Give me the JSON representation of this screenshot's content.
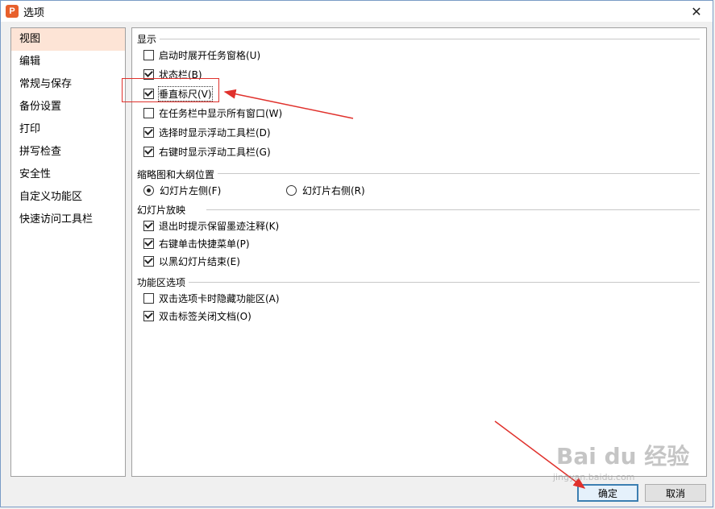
{
  "window": {
    "title": "选项",
    "close_symbol": "✕",
    "app_icon_letter": "P"
  },
  "sidebar": {
    "items": [
      {
        "label": "视图",
        "selected": true
      },
      {
        "label": "编辑"
      },
      {
        "label": "常规与保存"
      },
      {
        "label": "备份设置"
      },
      {
        "label": "打印"
      },
      {
        "label": "拼写检查"
      },
      {
        "label": "安全性"
      },
      {
        "label": "自定义功能区"
      },
      {
        "label": "快速访问工具栏"
      }
    ]
  },
  "groups": {
    "display": {
      "title": "显示",
      "items": [
        {
          "label": "启动时展开任务窗格(U)",
          "checked": false
        },
        {
          "label": "状态栏(B)",
          "checked": true
        },
        {
          "label": "垂直标尺(V)",
          "checked": true
        },
        {
          "label": "在任务栏中显示所有窗口(W)",
          "checked": false
        },
        {
          "label": "选择时显示浮动工具栏(D)",
          "checked": true
        },
        {
          "label": "右键时显示浮动工具栏(G)",
          "checked": true
        }
      ]
    },
    "thumbnail": {
      "title": "缩略图和大纲位置",
      "options": [
        {
          "label": "幻灯片左侧(F)",
          "selected": true
        },
        {
          "label": "幻灯片右侧(R)",
          "selected": false
        }
      ]
    },
    "slideshow": {
      "title": "幻灯片放映",
      "items": [
        {
          "label": "退出时提示保留墨迹注释(K)",
          "checked": true
        },
        {
          "label": "右键单击快捷菜单(P)",
          "checked": true
        },
        {
          "label": "以黑幻灯片结束(E)",
          "checked": true
        }
      ]
    },
    "ribbon": {
      "title": "功能区选项",
      "items": [
        {
          "label": "双击选项卡时隐藏功能区(A)",
          "checked": false
        },
        {
          "label": "双击标签关闭文档(O)",
          "checked": true
        }
      ]
    }
  },
  "buttons": {
    "ok": "确定",
    "cancel": "取消"
  },
  "watermark": {
    "main": "Bai du 经验",
    "sub": "jingyan.baidu.com"
  },
  "colors": {
    "accent_selected": "#fde4d6",
    "annotation": "#e0312c",
    "app_icon": "#e8602c"
  }
}
